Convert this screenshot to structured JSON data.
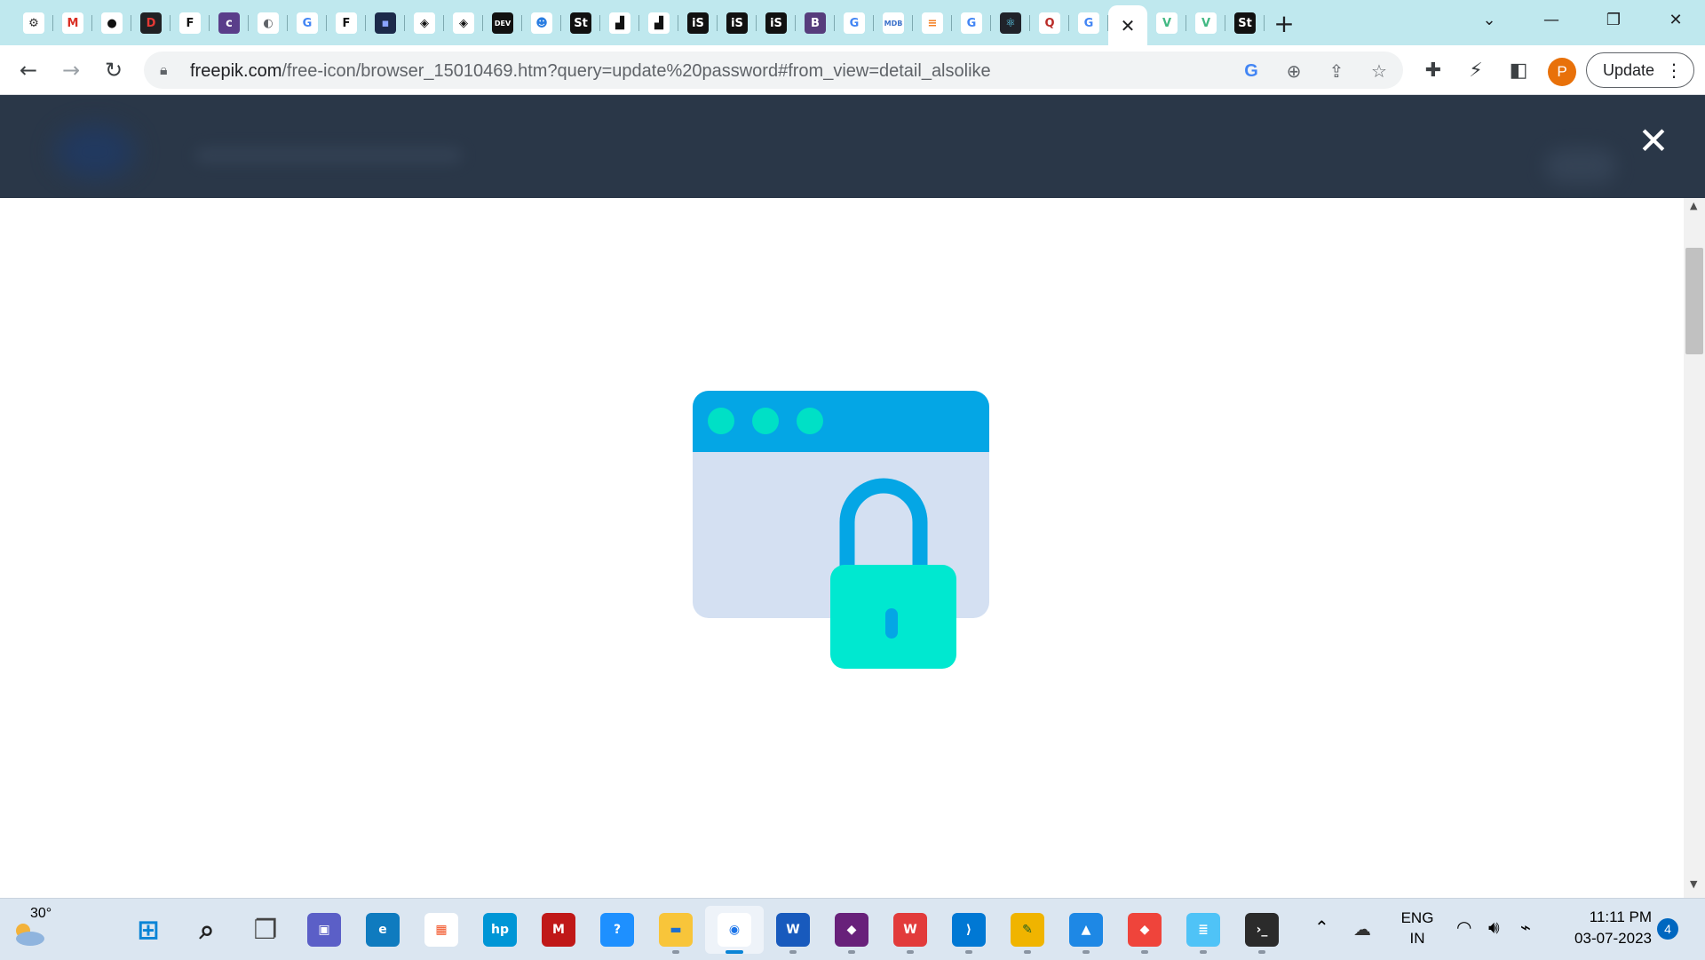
{
  "browser": {
    "tabs": [
      {
        "icon": "openai-icon",
        "glyph": "⚙",
        "bg": "#ffffff",
        "fg": "#2f2f2f"
      },
      {
        "icon": "gmail-icon",
        "glyph": "M",
        "bg": "#ffffff",
        "fg": "#d93025"
      },
      {
        "icon": "github-icon",
        "glyph": "●",
        "bg": "#ffffff",
        "fg": "#111111"
      },
      {
        "icon": "red-app-icon",
        "glyph": "D",
        "bg": "#202124",
        "fg": "#e53935"
      },
      {
        "icon": "frontendmentor-icon",
        "glyph": "F",
        "bg": "#ffffff",
        "fg": "#111111"
      },
      {
        "icon": "colorlib-icon",
        "glyph": "c",
        "bg": "#5a3e8a",
        "fg": "#ffffff"
      },
      {
        "icon": "globe-icon",
        "glyph": "◐",
        "bg": "#ffffff",
        "fg": "#5f6368"
      },
      {
        "icon": "google-icon",
        "glyph": "G",
        "bg": "#ffffff",
        "fg": "#4285f4"
      },
      {
        "icon": "frontendmentor-icon",
        "glyph": "F",
        "bg": "#ffffff",
        "fg": "#111111"
      },
      {
        "icon": "dark-app-icon",
        "glyph": "▪",
        "bg": "#1c2a4a",
        "fg": "#8aa4ff"
      },
      {
        "icon": "codepen-icon",
        "glyph": "◈",
        "bg": "#ffffff",
        "fg": "#111111"
      },
      {
        "icon": "codepen-icon",
        "glyph": "◈",
        "bg": "#ffffff",
        "fg": "#111111"
      },
      {
        "icon": "dev-to-icon",
        "glyph": "DEV",
        "bg": "#111111",
        "fg": "#ffffff"
      },
      {
        "icon": "reddit-icon",
        "glyph": "☻",
        "bg": "#ffffff",
        "fg": "#2a7de1"
      },
      {
        "icon": "st-icon",
        "glyph": "St",
        "bg": "#111111",
        "fg": "#ffffff"
      },
      {
        "icon": "unsplash-icon",
        "glyph": "▟",
        "bg": "#ffffff",
        "fg": "#111111"
      },
      {
        "icon": "unsplash-icon",
        "glyph": "▟",
        "bg": "#ffffff",
        "fg": "#111111"
      },
      {
        "icon": "istock-icon",
        "glyph": "iS",
        "bg": "#111111",
        "fg": "#ffffff"
      },
      {
        "icon": "istock-icon",
        "glyph": "iS",
        "bg": "#111111",
        "fg": "#ffffff"
      },
      {
        "icon": "istock-icon",
        "glyph": "iS",
        "bg": "#111111",
        "fg": "#ffffff"
      },
      {
        "icon": "bootstrap-icon",
        "glyph": "B",
        "bg": "#563d7c",
        "fg": "#ffffff"
      },
      {
        "icon": "google-icon",
        "glyph": "G",
        "bg": "#ffffff",
        "fg": "#4285f4"
      },
      {
        "icon": "mdb-icon",
        "glyph": "MDB",
        "bg": "#ffffff",
        "fg": "#3b71ca"
      },
      {
        "icon": "stackoverflow-icon",
        "glyph": "≡",
        "bg": "#ffffff",
        "fg": "#f48024"
      },
      {
        "icon": "google-icon",
        "glyph": "G",
        "bg": "#ffffff",
        "fg": "#4285f4"
      },
      {
        "icon": "react-icon",
        "glyph": "⚛",
        "bg": "#20232a",
        "fg": "#61dafb"
      },
      {
        "icon": "quora-icon",
        "glyph": "Q",
        "bg": "#ffffff",
        "fg": "#b92b27"
      },
      {
        "icon": "google-icon",
        "glyph": "G",
        "bg": "#ffffff",
        "fg": "#4285f4"
      },
      {
        "icon": "close-icon",
        "glyph": "✕",
        "bg": "#ffffff",
        "fg": "#202124",
        "active": true
      },
      {
        "icon": "vue-icon",
        "glyph": "V",
        "bg": "#ffffff",
        "fg": "#42b883"
      },
      {
        "icon": "vue-icon",
        "glyph": "V",
        "bg": "#ffffff",
        "fg": "#42b883"
      },
      {
        "icon": "st-icon",
        "glyph": "St",
        "bg": "#111111",
        "fg": "#ffffff"
      }
    ],
    "new_tab_glyph": "+",
    "url_host": "freepik.com",
    "url_path": "/free-icon/browser_15010469.htm?query=update%20password#from_view=detail_alsolike",
    "profile_initial": "P",
    "update_label": "Update"
  },
  "page": {
    "close_glyph": "✕",
    "illustration": {
      "icon": "browser-lock-icon",
      "colors": {
        "header": "#04a6e5",
        "dots": "#00e0c6",
        "window": "#d4e0f2",
        "shackle": "#04a6e5",
        "body": "#00e8d0",
        "keyhole": "#04a6e5"
      }
    }
  },
  "taskbar": {
    "temperature": "30°",
    "language_line1": "ENG",
    "language_line2": "IN",
    "time": "11:11 PM",
    "date": "03-07-2023",
    "notifications": "4",
    "apps": [
      {
        "icon": "windows-start-icon",
        "glyph": "⊞",
        "bg": "transparent",
        "fg": "#0a84d6"
      },
      {
        "icon": "search-icon",
        "glyph": "⌕",
        "bg": "transparent",
        "fg": "#222222"
      },
      {
        "icon": "task-view-icon",
        "glyph": "❐",
        "bg": "transparent",
        "fg": "#444444"
      },
      {
        "icon": "teams-chat-icon",
        "glyph": "▣",
        "bg": "#5b5fc7",
        "fg": "#ffffff"
      },
      {
        "icon": "edge-icon",
        "glyph": "e",
        "bg": "#0f7bbf",
        "fg": "#ffffff"
      },
      {
        "icon": "store-icon",
        "glyph": "▦",
        "bg": "#ffffff",
        "fg": "#f25022"
      },
      {
        "icon": "myhp-icon",
        "glyph": "hp",
        "bg": "#0096d6",
        "fg": "#ffffff"
      },
      {
        "icon": "mcafee-icon",
        "glyph": "M",
        "bg": "#c01818",
        "fg": "#ffffff"
      },
      {
        "icon": "get-help-icon",
        "glyph": "?",
        "bg": "#1e90ff",
        "fg": "#ffffff"
      },
      {
        "icon": "file-explorer-icon",
        "glyph": "▬",
        "bg": "#f8c53a",
        "fg": "#1e6fd0"
      },
      {
        "icon": "chrome-icon",
        "glyph": "◉",
        "bg": "#ffffff",
        "fg": "#1a73e8",
        "active": true
      },
      {
        "icon": "word-icon",
        "glyph": "W",
        "bg": "#185abd",
        "fg": "#ffffff"
      },
      {
        "icon": "visual-studio-icon",
        "glyph": "◆",
        "bg": "#68217a",
        "fg": "#ffffff"
      },
      {
        "icon": "wps-office-icon",
        "glyph": "W",
        "bg": "#e23b3b",
        "fg": "#ffffff"
      },
      {
        "icon": "vscode-icon",
        "glyph": "⟩",
        "bg": "#0078d4",
        "fg": "#ffffff"
      },
      {
        "icon": "paint-icon",
        "glyph": "✎",
        "bg": "#f0b400",
        "fg": "#1b5e20"
      },
      {
        "icon": "photos-icon",
        "glyph": "▲",
        "bg": "#1e88e5",
        "fg": "#ffffff"
      },
      {
        "icon": "anydesk-icon",
        "glyph": "◆",
        "bg": "#ef443b",
        "fg": "#ffffff"
      },
      {
        "icon": "notepad-icon",
        "glyph": "≣",
        "bg": "#4fc3f7",
        "fg": "#ffffff"
      },
      {
        "icon": "terminal-icon",
        "glyph": "›_",
        "bg": "#2b2b2b",
        "fg": "#ffffff"
      }
    ]
  }
}
